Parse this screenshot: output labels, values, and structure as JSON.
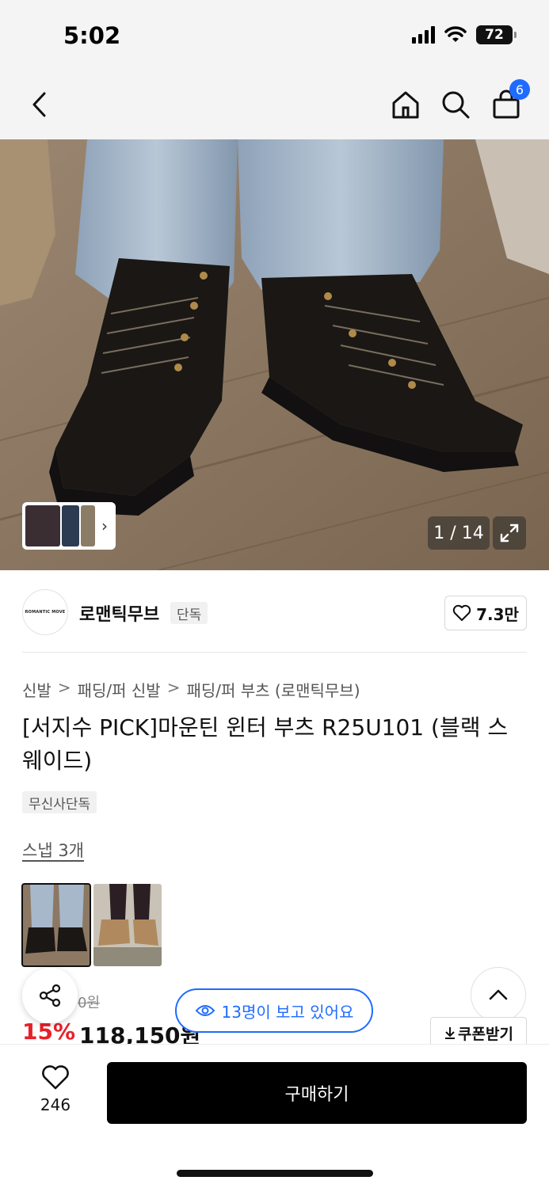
{
  "status_bar": {
    "time": "5:02",
    "battery": "72",
    "signal_icon": "cellular-signal-icon",
    "wifi_icon": "wifi-icon"
  },
  "nav": {
    "back_icon": "chevron-left-icon",
    "home_icon": "home-icon",
    "search_icon": "search-icon",
    "cart_icon": "shopping-bag-icon",
    "cart_count": "6"
  },
  "gallery": {
    "counter": "1 / 14",
    "expand_icon": "expand-icon",
    "thumb_chevron": "›"
  },
  "brand": {
    "logo_text": "ROMANTIC MOVE",
    "name": "로맨틱무브",
    "tag": "단독",
    "likes": "7.3만"
  },
  "breadcrumb": [
    "신발",
    "패딩/퍼 신발",
    "패딩/퍼 부츠 (로맨틱무브)"
  ],
  "breadcrumb_separator": ">",
  "product": {
    "title": "[서지수 PICK]마운틴 윈터 부츠 R25U101 (블랙 스웨이드)",
    "exclusive_tag": "무신사단독",
    "snap_link": "스냅 3개",
    "original_price_partial": "0원",
    "discount": "15%",
    "price": "118,150원"
  },
  "floating": {
    "viewers": "13명이 보고 있어요",
    "coupon": "쿠폰받기"
  },
  "bottom": {
    "wish_count": "246",
    "buy_label": "구매하기"
  },
  "colors": {
    "accent_blue": "#1f6bff",
    "discount_red": "#e8202a",
    "buy_black": "#000000"
  }
}
